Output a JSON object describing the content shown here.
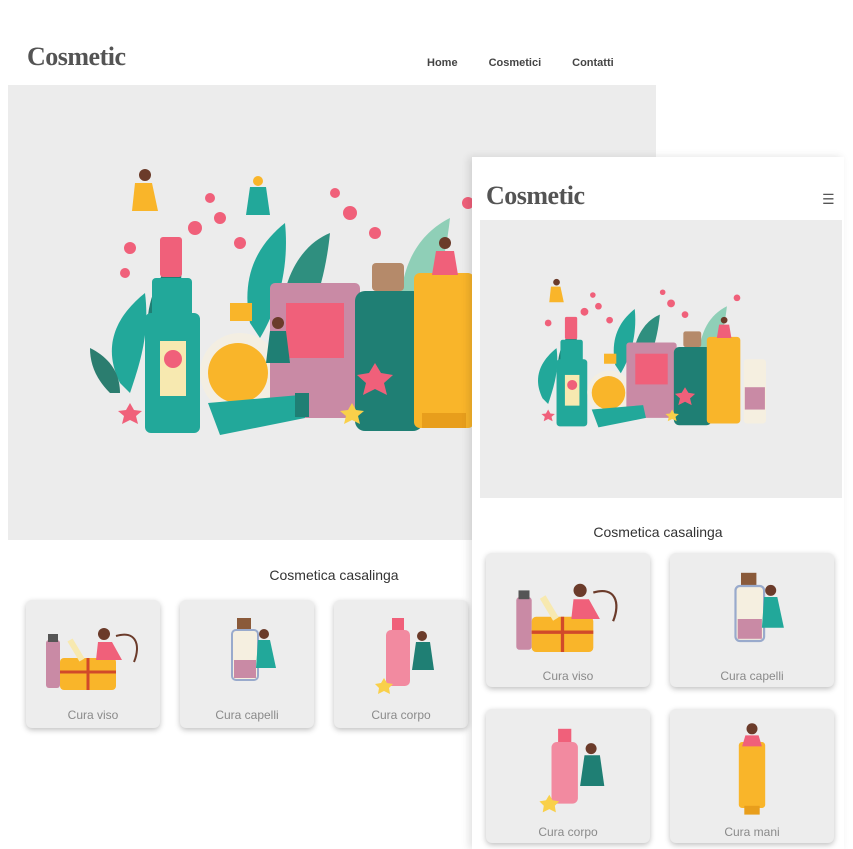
{
  "desktop": {
    "logo": "Cosmetic",
    "nav": [
      "Home",
      "Cosmetici",
      "Contatti"
    ],
    "section_title": "Cosmetica casalinga",
    "cards": [
      "Cura viso",
      "Cura capelli",
      "Cura corpo"
    ]
  },
  "mobile": {
    "logo": "Cosmetic",
    "menu_icon": "hamburger-icon",
    "section_title": "Cosmetica casalinga",
    "cards": [
      "Cura viso",
      "Cura capelli",
      "Cura corpo",
      "Cura mani"
    ]
  },
  "colors": {
    "hero_bg": "#ececec",
    "card_bg": "#ededed",
    "teal": "#22a89a",
    "pink": "#f0607a",
    "yellow": "#f9b52a",
    "mauve": "#c98aa5"
  }
}
